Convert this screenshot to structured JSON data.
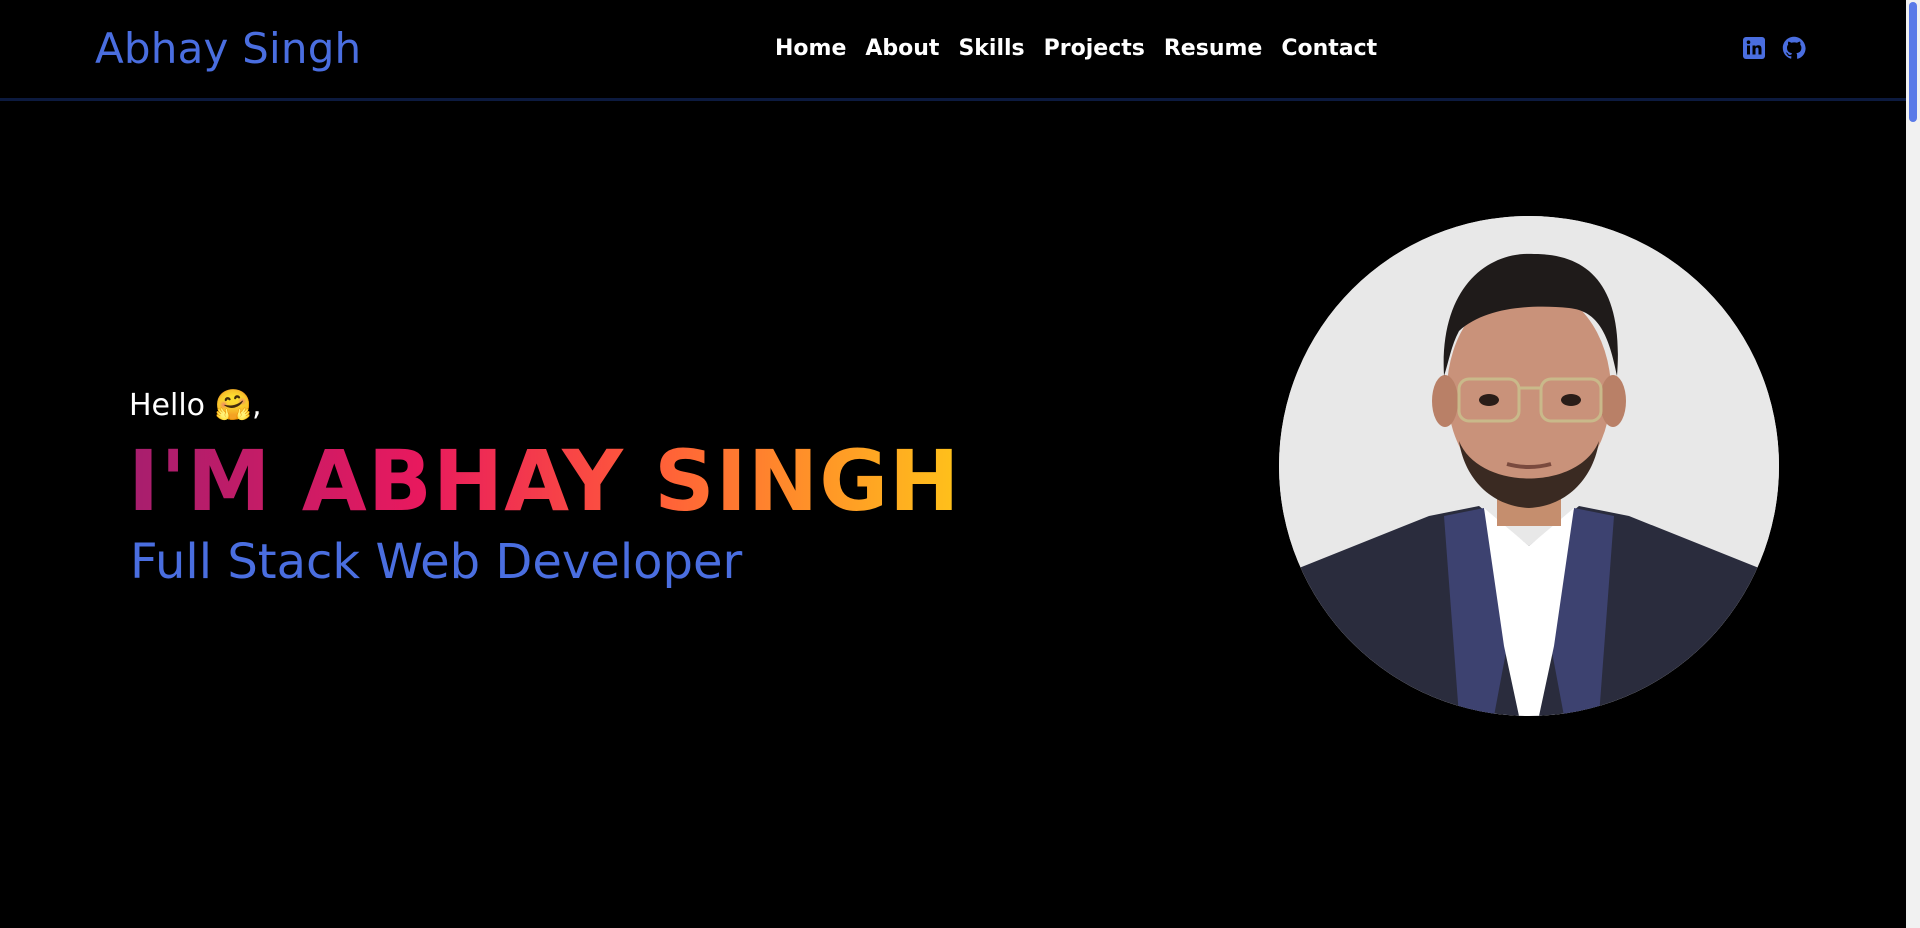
{
  "brand": {
    "name": "Abhay Singh"
  },
  "nav": {
    "items": [
      {
        "label": "Home"
      },
      {
        "label": "About"
      },
      {
        "label": "Skills"
      },
      {
        "label": "Projects"
      },
      {
        "label": "Resume"
      },
      {
        "label": "Contact"
      }
    ]
  },
  "socials": {
    "linkedin_icon": "linkedin-icon",
    "github_icon": "github-icon"
  },
  "hero": {
    "greeting": "Hello",
    "emoji": "🤗",
    "greeting_suffix": ",",
    "headline": "I'M ABHAY SINGH",
    "subtitle": "Full Stack Web Developer"
  },
  "colors": {
    "accent": "#4a6ee0",
    "background": "#000000",
    "gradient_start": "#a61e6e",
    "gradient_end": "#ffc21a"
  }
}
